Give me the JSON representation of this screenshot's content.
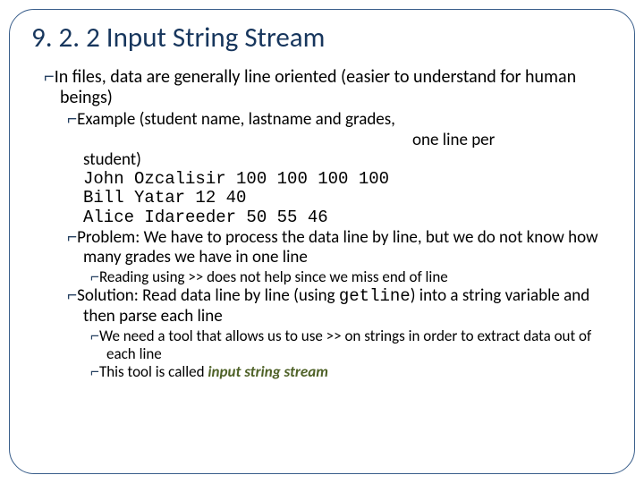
{
  "title": "9. 2. 2 Input String Stream",
  "bullet_icon": "⌐",
  "l1": {
    "text": "In files, data are generally line oriented (easier to understand for human beings)"
  },
  "example": {
    "lead": "Example (student name, lastname and grades,",
    "right_fragment": "one line per",
    "student_close": "student)",
    "rows": [
      "John Ozcalisir 100 100 100 100",
      "Bill Yatar 12 40",
      "Alice Idareeder 50 55 46"
    ]
  },
  "problem": {
    "label": "Problem",
    "text": ": We have to process the data line by line, but we do not know how many grades we have in one line",
    "sub": "Reading using >> does not help since we miss end of line"
  },
  "solution": {
    "label": "Solution",
    "pre_code": ": Read data line by line (using ",
    "code": "getline",
    "post_code": ") into a string variable and then parse each line",
    "sub1": "We need a tool that allows us to use >> on strings in order to extract data out of each line",
    "sub2_pre": "This tool is called ",
    "sub2_emph": "input string stream"
  }
}
